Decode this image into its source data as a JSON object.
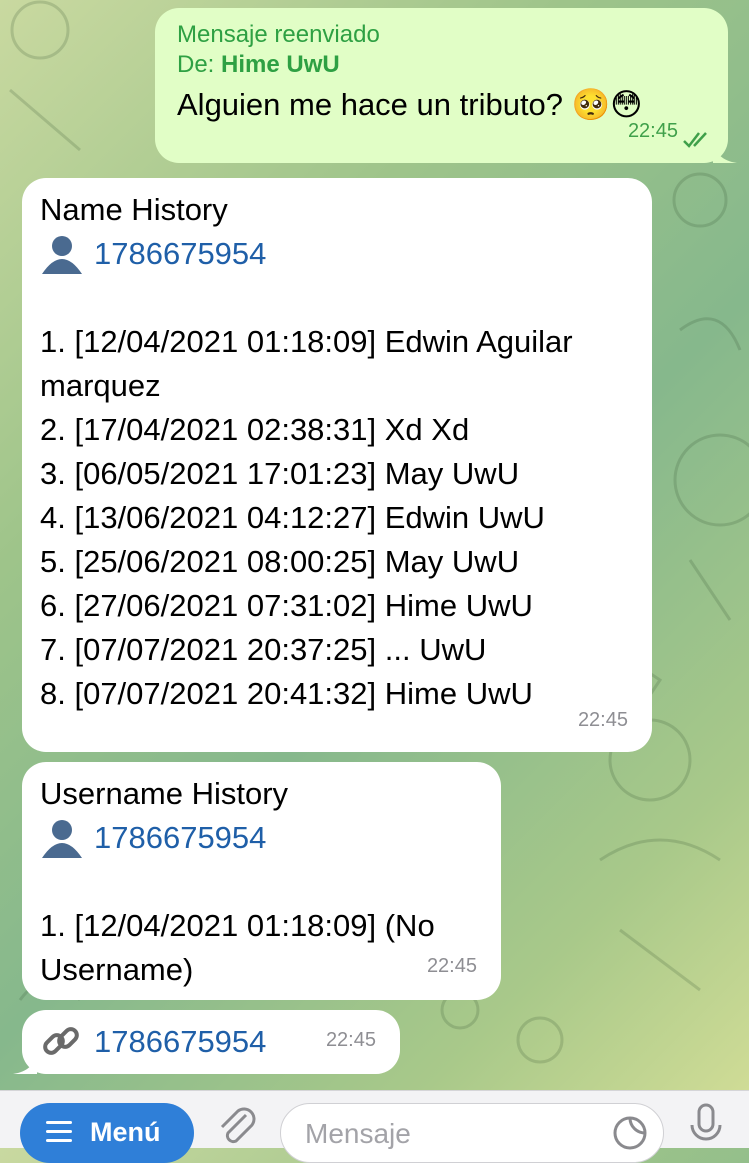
{
  "messages": {
    "forwarded": {
      "label": "Mensaje reenviado",
      "from_prefix": "De: ",
      "from_name": "Hime UwU",
      "text": "Alguien me hace un tributo? 🥺😳",
      "time": "22:45",
      "status_icon": "double-check-icon"
    },
    "name_history": {
      "title": "Name History",
      "user_icon": "user-silhouette-icon",
      "user_id": "1786675954",
      "lines": [
        "1. [12/04/2021 01:18:09] Edwin Aguilar",
        "marquez",
        "2. [17/04/2021 02:38:31] Xd Xd",
        "3. [06/05/2021 17:01:23] May UwU",
        "4. [13/06/2021 04:12:27] Edwin UwU",
        "5. [25/06/2021 08:00:25] May UwU",
        "6. [27/06/2021 07:31:02] Hime UwU",
        "7. [07/07/2021 20:37:25] ... UwU",
        "8. [07/07/2021 20:41:32] Hime UwU"
      ],
      "time": "22:45"
    },
    "username_history": {
      "title": "Username History",
      "user_icon": "user-silhouette-icon",
      "user_id": "1786675954",
      "lines": [
        "1. [12/04/2021 01:18:09] (No",
        "Username)"
      ],
      "time": "22:45"
    },
    "link_message": {
      "link_icon": "link-icon",
      "user_id": "1786675954",
      "time": "22:45"
    }
  },
  "bottom_bar": {
    "menu_label": "Menú",
    "input_placeholder": "Mensaje"
  },
  "colors": {
    "outgoing_bubble": "#e1fec6",
    "incoming_bubble": "#ffffff",
    "accent_blue": "#2f7fd8",
    "link_blue": "#1f5fa8",
    "forward_green": "#2ea043"
  }
}
